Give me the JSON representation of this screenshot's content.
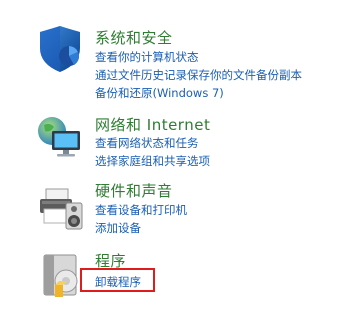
{
  "categories": [
    {
      "title": "系统和安全",
      "icon": "shield-icon",
      "links": [
        "查看你的计算机状态",
        "通过文件历史记录保存你的文件备份副本",
        "备份和还原(Windows 7)"
      ]
    },
    {
      "title": "网络和 Internet",
      "icon": "network-globe-icon",
      "links": [
        "查看网络状态和任务",
        "选择家庭组和共享选项"
      ]
    },
    {
      "title": "硬件和声音",
      "icon": "printer-speaker-icon",
      "links": [
        "查看设备和打印机",
        "添加设备"
      ]
    },
    {
      "title": "程序",
      "icon": "programs-box-icon",
      "links": [
        "卸载程序"
      ]
    }
  ],
  "colors": {
    "title": "#2e7d32",
    "link": "#1a5fb4",
    "highlight": "#e01b1b"
  }
}
